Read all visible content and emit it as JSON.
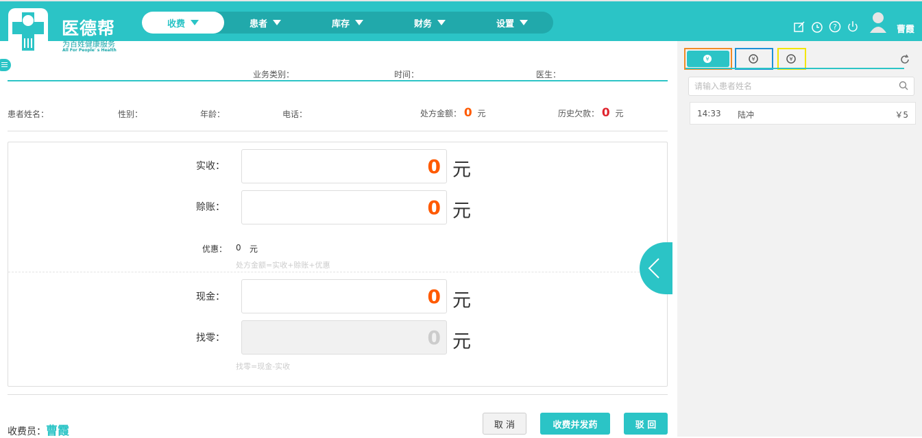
{
  "brand": {
    "name": "医德帮",
    "slogan": "为百姓健康服务",
    "slogan_en": "All For People' s Health"
  },
  "nav": [
    {
      "label": "收费",
      "active": true
    },
    {
      "label": "患者",
      "active": false
    },
    {
      "label": "库存",
      "active": false
    },
    {
      "label": "财务",
      "active": false
    },
    {
      "label": "设置",
      "active": false
    }
  ],
  "user": {
    "name": "曹霞"
  },
  "header": {
    "business_type": "业务类别：",
    "time": "时间：",
    "doctor": "医生："
  },
  "patient": {
    "name_label": "患者姓名：",
    "gender_label": "性别：",
    "age_label": "年龄：",
    "phone_label": "电话：",
    "rx_amount_label": "处方金额：",
    "rx_amount": "0",
    "rx_unit": "元",
    "history_debt_label": "历史欠款：",
    "history_debt": "0",
    "history_unit": "元"
  },
  "payment": {
    "received_label": "实收：",
    "received": "0",
    "credit_label": "赊账：",
    "credit": "0",
    "discount_label": "优惠：",
    "discount": "0",
    "discount_unit": "元",
    "formula1": "处方金额=实收+赊账+优惠",
    "cash_label": "现金：",
    "cash": "0",
    "change_label": "找零：",
    "change": "0",
    "formula2": "找零=现金-实收",
    "unit": "元"
  },
  "footer": {
    "cashier_label": "收费员：",
    "cashier": "曹霞",
    "cancel": "取 消",
    "dispense": "收费并发药",
    "reject": "驳 回"
  },
  "right": {
    "search_placeholder": "请输入患者姓名",
    "records": [
      {
        "time": "14:33",
        "name": "陆冲",
        "amount": "￥5"
      }
    ]
  },
  "colors": {
    "accent": "#2bc4c6",
    "amount": "#ff5a00",
    "debt": "#e0242e"
  }
}
